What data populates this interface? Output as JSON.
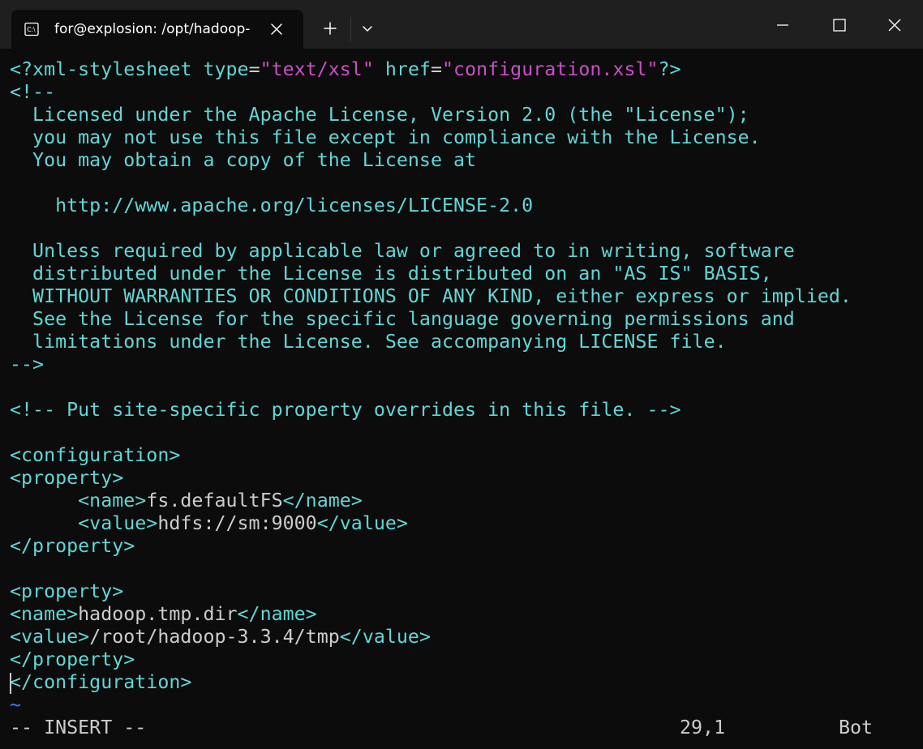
{
  "window": {
    "tab_title": "for@explosion: /opt/hadoop-",
    "icons": {
      "tab": "terminal-icon",
      "close_tab": "close-icon",
      "new_tab": "plus-icon",
      "dropdown": "chevron-down-icon",
      "minimize": "minimize-icon",
      "maximize": "maximize-icon",
      "close_window": "close-icon"
    }
  },
  "editor": {
    "lines": [
      [
        {
          "t": "<?xml-stylesheet ",
          "c": "tag"
        },
        {
          "t": "type",
          "c": "tag"
        },
        {
          "t": "=",
          "c": "txt"
        },
        {
          "t": "\"text/xsl\"",
          "c": "str"
        },
        {
          "t": " ",
          "c": "txt"
        },
        {
          "t": "href",
          "c": "tag"
        },
        {
          "t": "=",
          "c": "txt"
        },
        {
          "t": "\"configuration.xsl\"",
          "c": "str"
        },
        {
          "t": "?>",
          "c": "tag"
        }
      ],
      [
        {
          "t": "<!--",
          "c": "tag"
        }
      ],
      [
        {
          "t": "  Licensed under the Apache License, Version 2.0 (the \"License\");",
          "c": "tag"
        }
      ],
      [
        {
          "t": "  you may not use this file except in compliance with the License.",
          "c": "tag"
        }
      ],
      [
        {
          "t": "  You may obtain a copy of the License at",
          "c": "tag"
        }
      ],
      [],
      [
        {
          "t": "    http://www.apache.org/licenses/LICENSE-2.0",
          "c": "tag"
        }
      ],
      [],
      [
        {
          "t": "  Unless required by applicable law or agreed to in writing, software",
          "c": "tag"
        }
      ],
      [
        {
          "t": "  distributed under the License is distributed on an \"AS IS\" BASIS,",
          "c": "tag"
        }
      ],
      [
        {
          "t": "  WITHOUT WARRANTIES OR CONDITIONS OF ANY KIND, either express or implied.",
          "c": "tag"
        }
      ],
      [
        {
          "t": "  See the License for the specific language governing permissions and",
          "c": "tag"
        }
      ],
      [
        {
          "t": "  limitations under the License. See accompanying LICENSE file.",
          "c": "tag"
        }
      ],
      [
        {
          "t": "-->",
          "c": "tag"
        }
      ],
      [],
      [
        {
          "t": "<!-- Put site-specific property overrides in this file. -->",
          "c": "tag"
        }
      ],
      [],
      [
        {
          "t": "<configuration>",
          "c": "tag"
        }
      ],
      [
        {
          "t": "<property>",
          "c": "tag"
        }
      ],
      [
        {
          "t": "      ",
          "c": "txt"
        },
        {
          "t": "<name>",
          "c": "tag"
        },
        {
          "t": "fs.defaultFS",
          "c": "txt"
        },
        {
          "t": "</name>",
          "c": "tag"
        }
      ],
      [
        {
          "t": "      ",
          "c": "txt"
        },
        {
          "t": "<value>",
          "c": "tag"
        },
        {
          "t": "hdfs://sm:9000",
          "c": "txt"
        },
        {
          "t": "</value>",
          "c": "tag"
        }
      ],
      [
        {
          "t": "</property>",
          "c": "tag"
        }
      ],
      [],
      [
        {
          "t": "<property>",
          "c": "tag"
        }
      ],
      [
        {
          "t": "<name>",
          "c": "tag"
        },
        {
          "t": "hadoop.tmp.dir",
          "c": "txt"
        },
        {
          "t": "</name>",
          "c": "tag"
        }
      ],
      [
        {
          "t": "<value>",
          "c": "tag"
        },
        {
          "t": "/root/hadoop-3.3.4/tmp",
          "c": "txt"
        },
        {
          "t": "</value>",
          "c": "tag"
        }
      ],
      [
        {
          "t": "</property>",
          "c": "tag"
        }
      ],
      [
        {
          "t": "</configuration>",
          "c": "tag"
        }
      ],
      [
        {
          "t": "~",
          "c": "tilde"
        }
      ]
    ],
    "status": {
      "mode": "-- INSERT --",
      "position": "29,1",
      "scroll": "Bot"
    },
    "colors": {
      "tag": "#61d6d6",
      "string": "#c94fc6",
      "text": "#cccccc",
      "tilde": "#3b78ff",
      "background": "#0c0c0c"
    }
  }
}
